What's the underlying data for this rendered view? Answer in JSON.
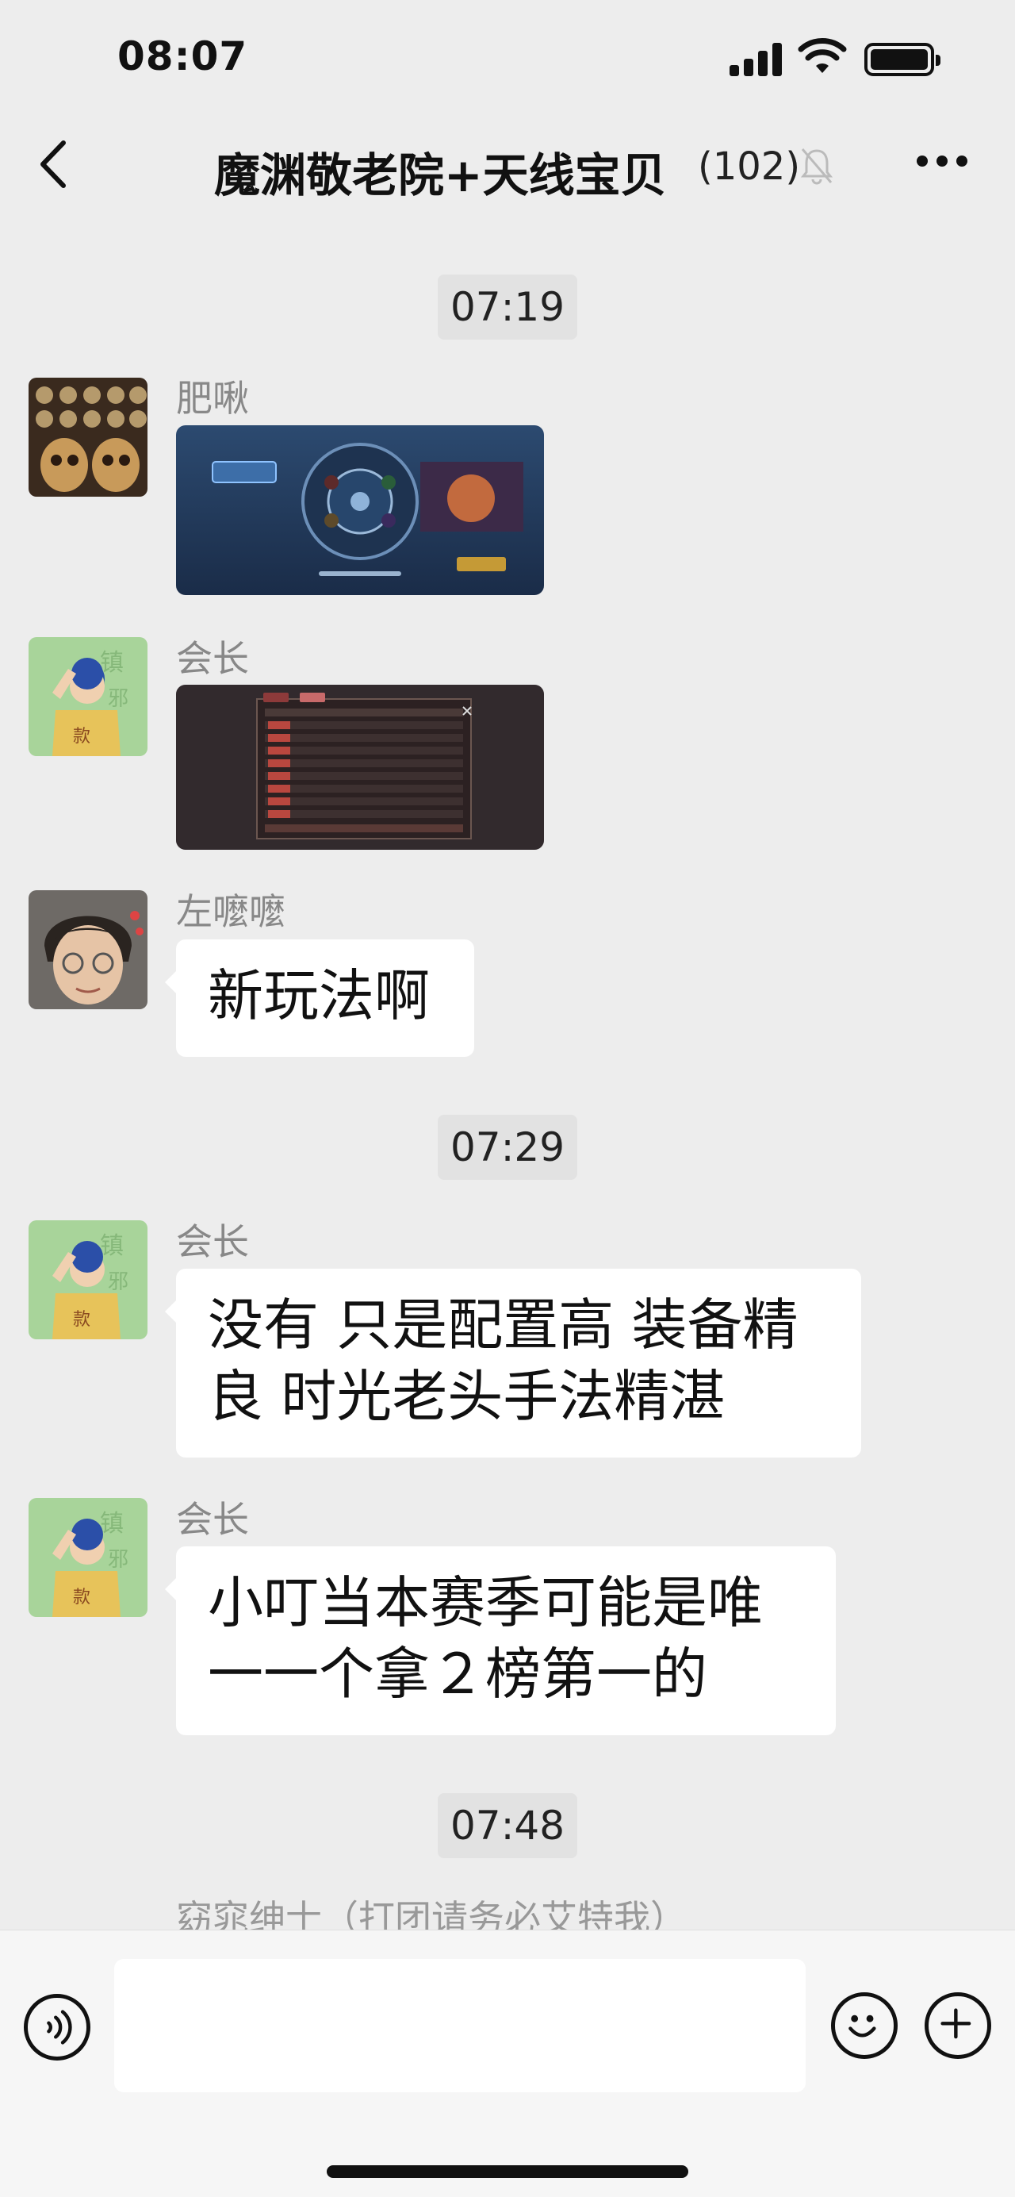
{
  "status_bar": {
    "time": "08:07"
  },
  "nav": {
    "title": "魔渊敬老院+天线宝贝",
    "member_count": "(102)"
  },
  "messages": [
    {
      "type": "time",
      "text": "07:19"
    },
    {
      "type": "image",
      "sender": "肥啾",
      "image": "game-battle-screenshot"
    },
    {
      "type": "image",
      "sender": "会长",
      "image": "game-leaderboard-screenshot"
    },
    {
      "type": "text",
      "sender": "左嚒嚒",
      "text": "新玩法啊"
    },
    {
      "type": "time",
      "text": "07:29"
    },
    {
      "type": "text",
      "sender": "会长",
      "line1": "没有 只是配置高 装备精",
      "line2": "良  时光老头手法精湛"
    },
    {
      "type": "text",
      "sender": "会长",
      "line1": "小叮当本赛季可能是唯",
      "line2": "一一个拿２榜第一的"
    },
    {
      "type": "time",
      "text": "07:48"
    },
    {
      "type": "partial",
      "sender": "窈窕绅士（打团请务必艾特我）"
    }
  ],
  "input": {
    "value": "",
    "placeholder": ""
  },
  "icons": {
    "back": "back-icon",
    "mute": "mute-icon",
    "more": "more-icon",
    "voice": "voice-icon",
    "emoji": "emoji-icon",
    "plus": "plus-icon"
  },
  "colors": {
    "background": "#ededed",
    "bubble": "#ffffff",
    "input_bar": "#f6f6f6",
    "meta_text": "#888888"
  }
}
